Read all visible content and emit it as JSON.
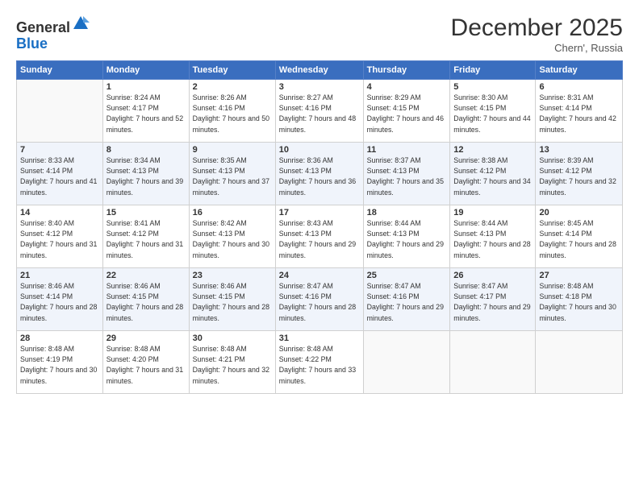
{
  "logo": {
    "general": "General",
    "blue": "Blue"
  },
  "header": {
    "title": "December 2025",
    "location": "Chern', Russia"
  },
  "columns": [
    "Sunday",
    "Monday",
    "Tuesday",
    "Wednesday",
    "Thursday",
    "Friday",
    "Saturday"
  ],
  "weeks": [
    [
      {
        "day": "",
        "sunrise": "",
        "sunset": "",
        "daylight": ""
      },
      {
        "day": "1",
        "sunrise": "Sunrise: 8:24 AM",
        "sunset": "Sunset: 4:17 PM",
        "daylight": "Daylight: 7 hours and 52 minutes."
      },
      {
        "day": "2",
        "sunrise": "Sunrise: 8:26 AM",
        "sunset": "Sunset: 4:16 PM",
        "daylight": "Daylight: 7 hours and 50 minutes."
      },
      {
        "day": "3",
        "sunrise": "Sunrise: 8:27 AM",
        "sunset": "Sunset: 4:16 PM",
        "daylight": "Daylight: 7 hours and 48 minutes."
      },
      {
        "day": "4",
        "sunrise": "Sunrise: 8:29 AM",
        "sunset": "Sunset: 4:15 PM",
        "daylight": "Daylight: 7 hours and 46 minutes."
      },
      {
        "day": "5",
        "sunrise": "Sunrise: 8:30 AM",
        "sunset": "Sunset: 4:15 PM",
        "daylight": "Daylight: 7 hours and 44 minutes."
      },
      {
        "day": "6",
        "sunrise": "Sunrise: 8:31 AM",
        "sunset": "Sunset: 4:14 PM",
        "daylight": "Daylight: 7 hours and 42 minutes."
      }
    ],
    [
      {
        "day": "7",
        "sunrise": "Sunrise: 8:33 AM",
        "sunset": "Sunset: 4:14 PM",
        "daylight": "Daylight: 7 hours and 41 minutes."
      },
      {
        "day": "8",
        "sunrise": "Sunrise: 8:34 AM",
        "sunset": "Sunset: 4:13 PM",
        "daylight": "Daylight: 7 hours and 39 minutes."
      },
      {
        "day": "9",
        "sunrise": "Sunrise: 8:35 AM",
        "sunset": "Sunset: 4:13 PM",
        "daylight": "Daylight: 7 hours and 37 minutes."
      },
      {
        "day": "10",
        "sunrise": "Sunrise: 8:36 AM",
        "sunset": "Sunset: 4:13 PM",
        "daylight": "Daylight: 7 hours and 36 minutes."
      },
      {
        "day": "11",
        "sunrise": "Sunrise: 8:37 AM",
        "sunset": "Sunset: 4:13 PM",
        "daylight": "Daylight: 7 hours and 35 minutes."
      },
      {
        "day": "12",
        "sunrise": "Sunrise: 8:38 AM",
        "sunset": "Sunset: 4:12 PM",
        "daylight": "Daylight: 7 hours and 34 minutes."
      },
      {
        "day": "13",
        "sunrise": "Sunrise: 8:39 AM",
        "sunset": "Sunset: 4:12 PM",
        "daylight": "Daylight: 7 hours and 32 minutes."
      }
    ],
    [
      {
        "day": "14",
        "sunrise": "Sunrise: 8:40 AM",
        "sunset": "Sunset: 4:12 PM",
        "daylight": "Daylight: 7 hours and 31 minutes."
      },
      {
        "day": "15",
        "sunrise": "Sunrise: 8:41 AM",
        "sunset": "Sunset: 4:12 PM",
        "daylight": "Daylight: 7 hours and 31 minutes."
      },
      {
        "day": "16",
        "sunrise": "Sunrise: 8:42 AM",
        "sunset": "Sunset: 4:13 PM",
        "daylight": "Daylight: 7 hours and 30 minutes."
      },
      {
        "day": "17",
        "sunrise": "Sunrise: 8:43 AM",
        "sunset": "Sunset: 4:13 PM",
        "daylight": "Daylight: 7 hours and 29 minutes."
      },
      {
        "day": "18",
        "sunrise": "Sunrise: 8:44 AM",
        "sunset": "Sunset: 4:13 PM",
        "daylight": "Daylight: 7 hours and 29 minutes."
      },
      {
        "day": "19",
        "sunrise": "Sunrise: 8:44 AM",
        "sunset": "Sunset: 4:13 PM",
        "daylight": "Daylight: 7 hours and 28 minutes."
      },
      {
        "day": "20",
        "sunrise": "Sunrise: 8:45 AM",
        "sunset": "Sunset: 4:14 PM",
        "daylight": "Daylight: 7 hours and 28 minutes."
      }
    ],
    [
      {
        "day": "21",
        "sunrise": "Sunrise: 8:46 AM",
        "sunset": "Sunset: 4:14 PM",
        "daylight": "Daylight: 7 hours and 28 minutes."
      },
      {
        "day": "22",
        "sunrise": "Sunrise: 8:46 AM",
        "sunset": "Sunset: 4:15 PM",
        "daylight": "Daylight: 7 hours and 28 minutes."
      },
      {
        "day": "23",
        "sunrise": "Sunrise: 8:46 AM",
        "sunset": "Sunset: 4:15 PM",
        "daylight": "Daylight: 7 hours and 28 minutes."
      },
      {
        "day": "24",
        "sunrise": "Sunrise: 8:47 AM",
        "sunset": "Sunset: 4:16 PM",
        "daylight": "Daylight: 7 hours and 28 minutes."
      },
      {
        "day": "25",
        "sunrise": "Sunrise: 8:47 AM",
        "sunset": "Sunset: 4:16 PM",
        "daylight": "Daylight: 7 hours and 29 minutes."
      },
      {
        "day": "26",
        "sunrise": "Sunrise: 8:47 AM",
        "sunset": "Sunset: 4:17 PM",
        "daylight": "Daylight: 7 hours and 29 minutes."
      },
      {
        "day": "27",
        "sunrise": "Sunrise: 8:48 AM",
        "sunset": "Sunset: 4:18 PM",
        "daylight": "Daylight: 7 hours and 30 minutes."
      }
    ],
    [
      {
        "day": "28",
        "sunrise": "Sunrise: 8:48 AM",
        "sunset": "Sunset: 4:19 PM",
        "daylight": "Daylight: 7 hours and 30 minutes."
      },
      {
        "day": "29",
        "sunrise": "Sunrise: 8:48 AM",
        "sunset": "Sunset: 4:20 PM",
        "daylight": "Daylight: 7 hours and 31 minutes."
      },
      {
        "day": "30",
        "sunrise": "Sunrise: 8:48 AM",
        "sunset": "Sunset: 4:21 PM",
        "daylight": "Daylight: 7 hours and 32 minutes."
      },
      {
        "day": "31",
        "sunrise": "Sunrise: 8:48 AM",
        "sunset": "Sunset: 4:22 PM",
        "daylight": "Daylight: 7 hours and 33 minutes."
      },
      {
        "day": "",
        "sunrise": "",
        "sunset": "",
        "daylight": ""
      },
      {
        "day": "",
        "sunrise": "",
        "sunset": "",
        "daylight": ""
      },
      {
        "day": "",
        "sunrise": "",
        "sunset": "",
        "daylight": ""
      }
    ]
  ]
}
